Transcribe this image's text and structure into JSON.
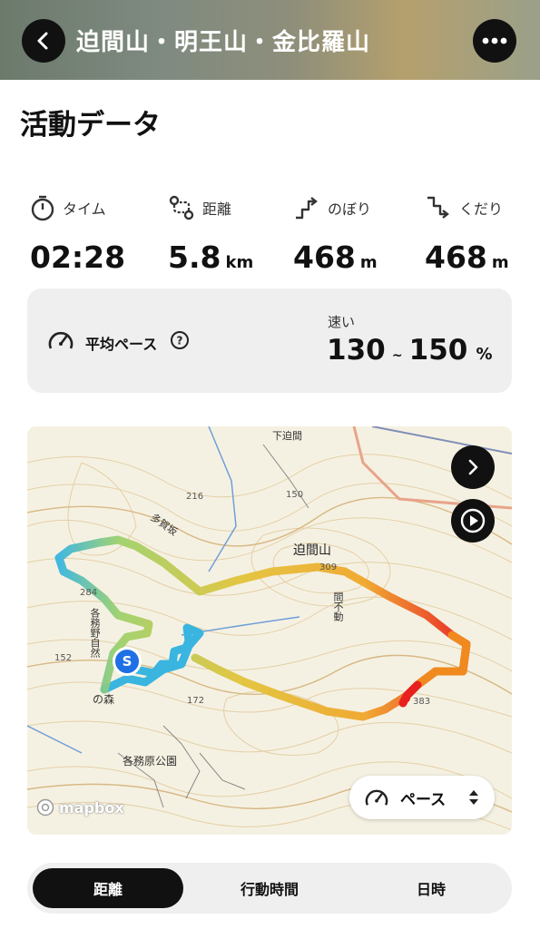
{
  "header": {
    "title": "迫間山・明王山・金比羅山",
    "back_icon": "chevron-left-icon",
    "more_icon": "ellipsis-icon"
  },
  "section_title": "活動データ",
  "stats": [
    {
      "label": "タイム",
      "value": "02:28",
      "unit": "",
      "icon": "stopwatch-icon"
    },
    {
      "label": "距離",
      "value": "5.8",
      "unit": "km",
      "icon": "route-icon"
    },
    {
      "label": "のぼり",
      "value": "468",
      "unit": "m",
      "icon": "ascent-icon"
    },
    {
      "label": "くだり",
      "value": "468",
      "unit": "m",
      "icon": "descent-icon"
    }
  ],
  "pace": {
    "label": "平均ペース",
    "speed_label": "速い",
    "low": "130",
    "separator": "~",
    "high": "150",
    "unit": "%"
  },
  "map": {
    "places": {
      "peak": "迫間山",
      "park": "各務原公園",
      "mori": "の森",
      "fudo": "間不動",
      "tagatoge": "多賀坂",
      "vertical": "各務野自然",
      "shimo": "下迫間"
    },
    "elev": {
      "e216": "216",
      "e284": "284",
      "e152": "152",
      "e172": "172",
      "e383": "383",
      "e150": "150",
      "e309": "309"
    },
    "start_marker": "S",
    "attribution": "mapbox",
    "mode_label": "ペース",
    "route_colors": {
      "start": "#39b5e0",
      "mid": "#e3c33a",
      "hot": "#f08a1e",
      "end": "#e8201e"
    }
  },
  "tabs": {
    "distance": "距離",
    "active_time": "行動時間",
    "datetime": "日時",
    "selected": "距離"
  }
}
